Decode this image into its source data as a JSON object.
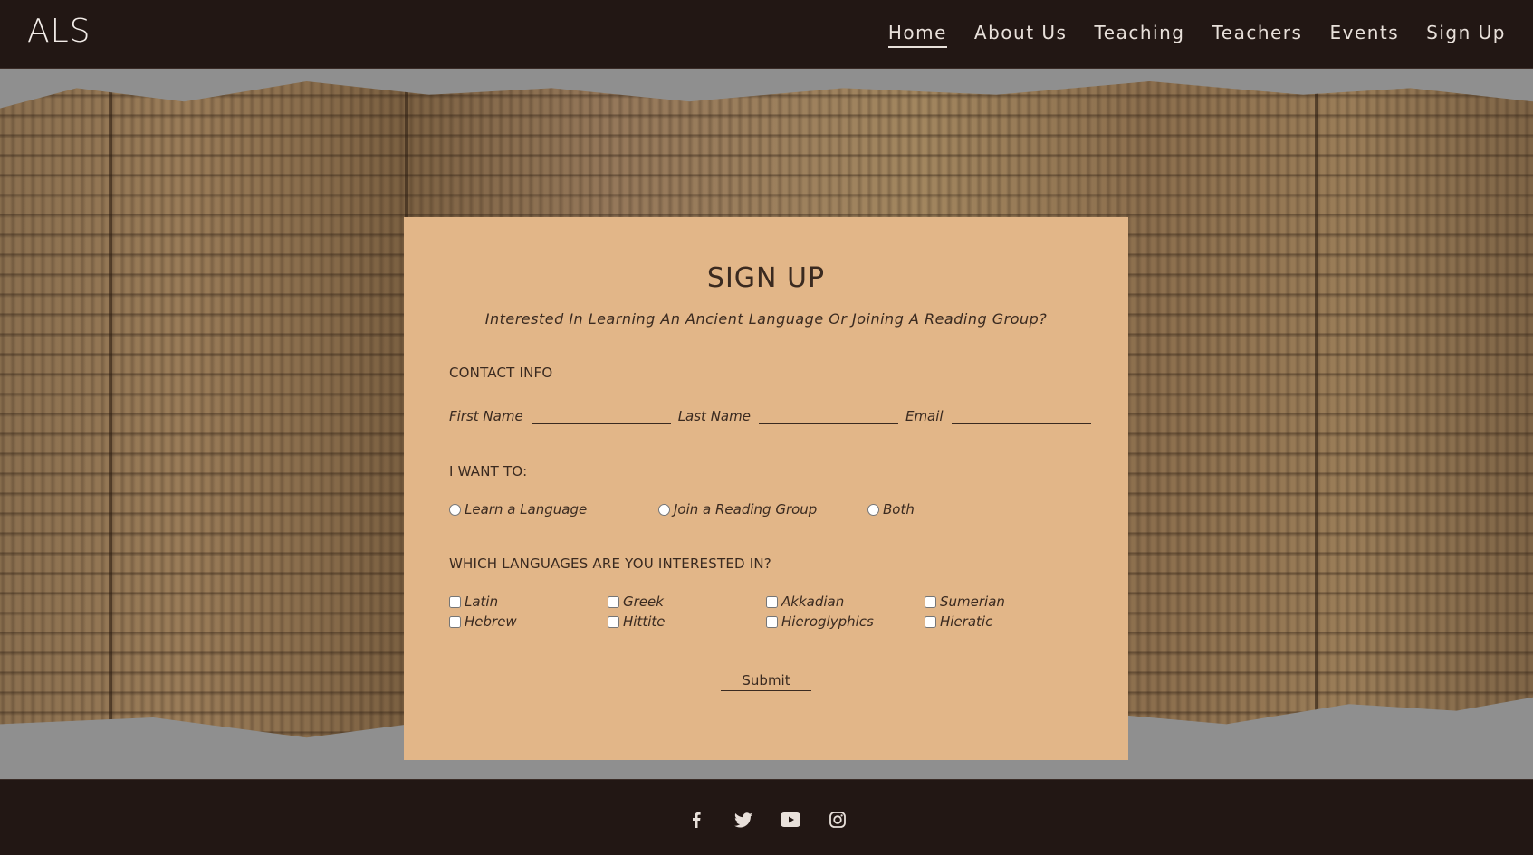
{
  "header": {
    "logo": "ALS",
    "nav": [
      "Home",
      "About Us",
      "Teaching",
      "Teachers",
      "Events",
      "Sign Up"
    ],
    "active": "Home"
  },
  "form": {
    "title": "SIGN UP",
    "subtitle": "Interested In Learning An Ancient Language Or Joining A Reading Group?",
    "contact_label": "CONTACT INFO",
    "fields": [
      {
        "label": "First Name",
        "value": ""
      },
      {
        "label": "Last Name",
        "value": ""
      },
      {
        "label": "Email",
        "value": ""
      }
    ],
    "want_label": "I WANT TO:",
    "want_options": [
      "Learn a Language",
      "Join a Reading Group",
      "Both"
    ],
    "languages_label": "WHICH LANGUAGES ARE YOU INTERESTED IN?",
    "languages": [
      "Latin",
      "Greek",
      "Akkadian",
      "Sumerian",
      "Hebrew",
      "Hittite",
      "Hieroglyphics",
      "Hieratic"
    ],
    "submit": "Submit"
  },
  "footer": {
    "icons": [
      "facebook-icon",
      "twitter-icon",
      "youtube-icon",
      "instagram-icon"
    ]
  },
  "colors": {
    "header_bg": "#221714",
    "card_bg": "#e2b688",
    "text": "#3a2a20"
  }
}
